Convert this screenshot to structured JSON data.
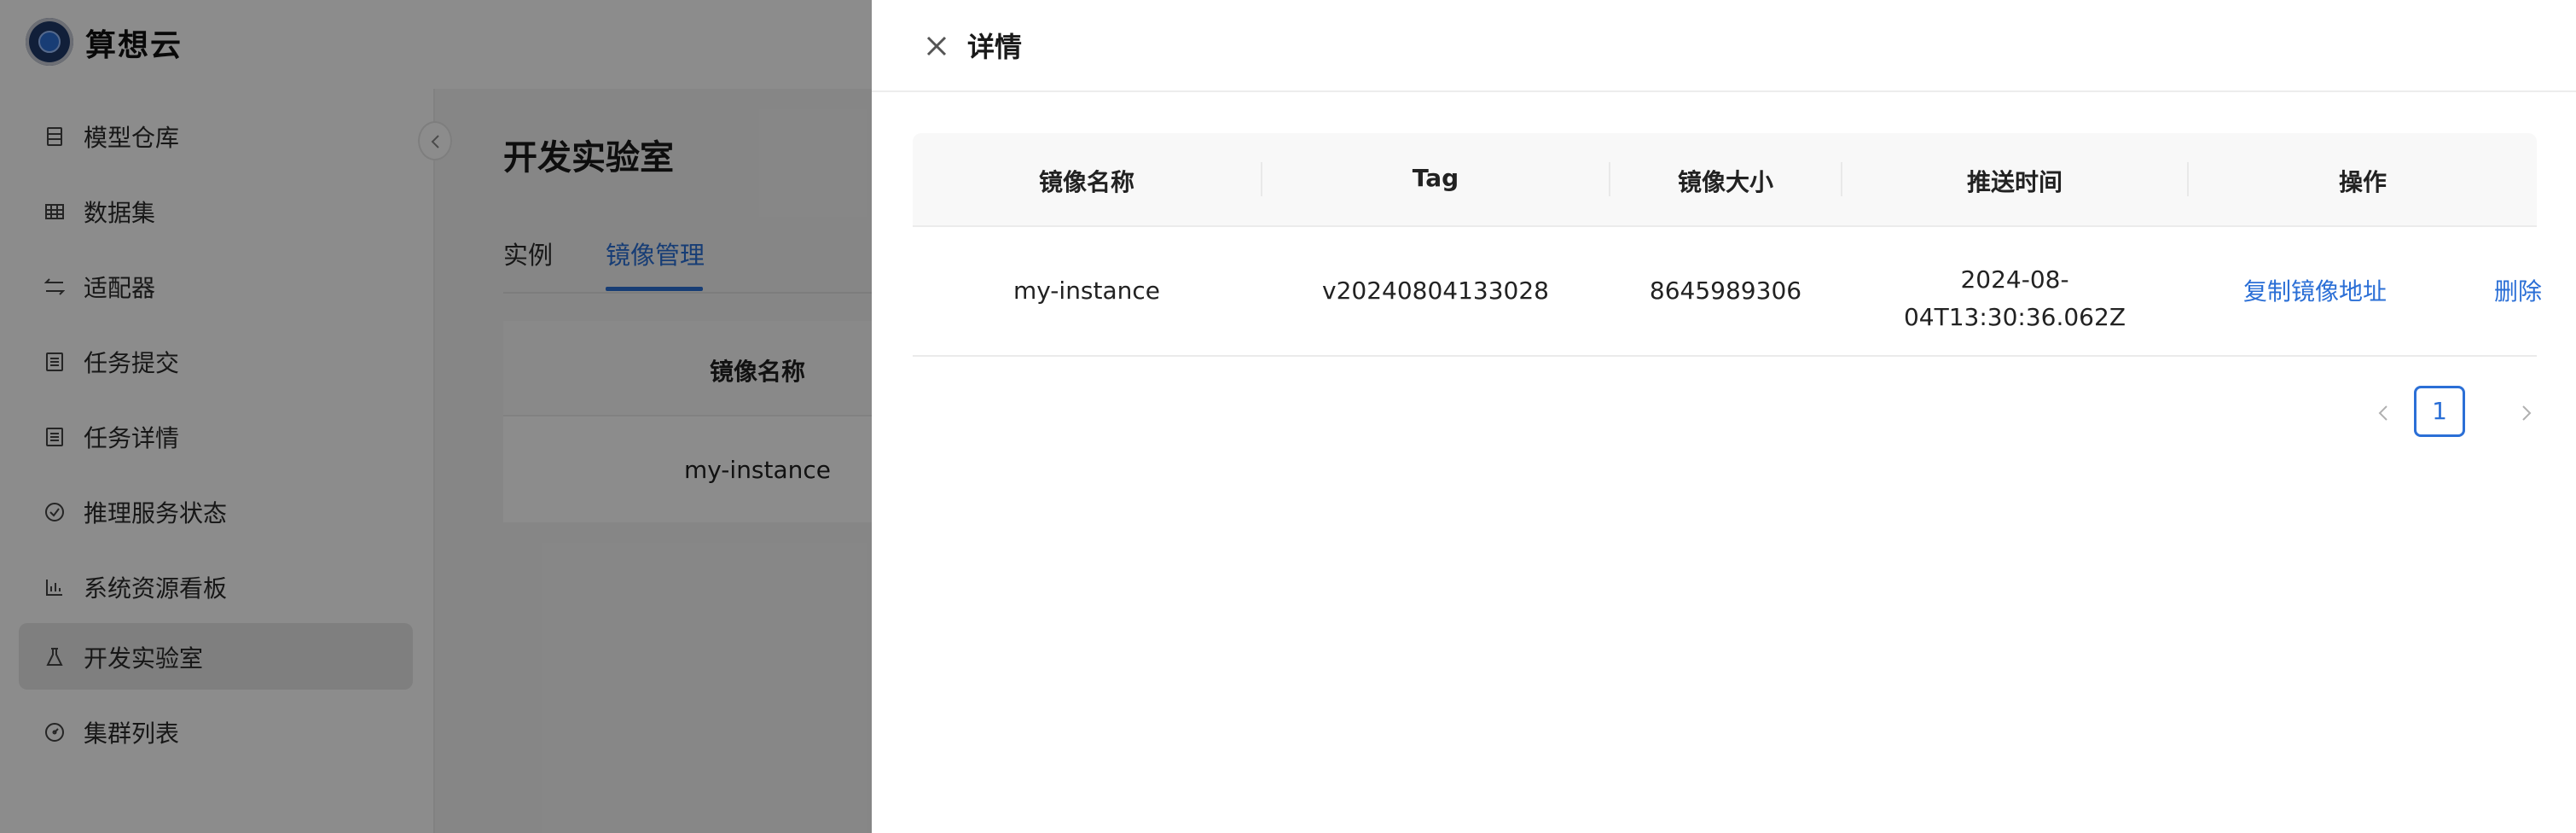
{
  "app": {
    "brand": "算想云"
  },
  "sidebar": {
    "items": [
      {
        "label": "模型仓库",
        "icon": "database-icon",
        "active": false
      },
      {
        "label": "数据集",
        "icon": "table-icon",
        "active": false
      },
      {
        "label": "适配器",
        "icon": "swap-icon",
        "active": false
      },
      {
        "label": "任务提交",
        "icon": "list-icon",
        "active": false
      },
      {
        "label": "任务详情",
        "icon": "list-icon",
        "active": false
      },
      {
        "label": "推理服务状态",
        "icon": "check-circle-icon",
        "active": false
      },
      {
        "label": "系统资源看板",
        "icon": "bar-chart-icon",
        "active": false
      },
      {
        "label": "开发实验室",
        "icon": "flask-icon",
        "active": true
      },
      {
        "label": "集群列表",
        "icon": "dashboard-icon",
        "active": false
      }
    ]
  },
  "main": {
    "title": "开发实验室",
    "tabs": [
      {
        "label": "实例",
        "active": false
      },
      {
        "label": "镜像管理",
        "active": true
      }
    ],
    "table": {
      "header": "镜像名称",
      "row": "my-instance"
    }
  },
  "drawer": {
    "title": "详情",
    "table": {
      "columns": [
        "镜像名称",
        "Tag",
        "镜像大小",
        "推送时间",
        "操作"
      ],
      "rows": [
        {
          "name": "my-instance",
          "tag": "v20240804133028",
          "size": "8645989306",
          "time_line1": "2024-08-",
          "time_line2": "04T13:30:36.062Z",
          "action_copy": "复制镜像地址",
          "action_delete": "删除"
        }
      ]
    },
    "pagination": {
      "current_page": "1"
    }
  },
  "colors": {
    "accent": "#2b6fd6",
    "overlay": "rgba(0,0,0,0.45)"
  }
}
